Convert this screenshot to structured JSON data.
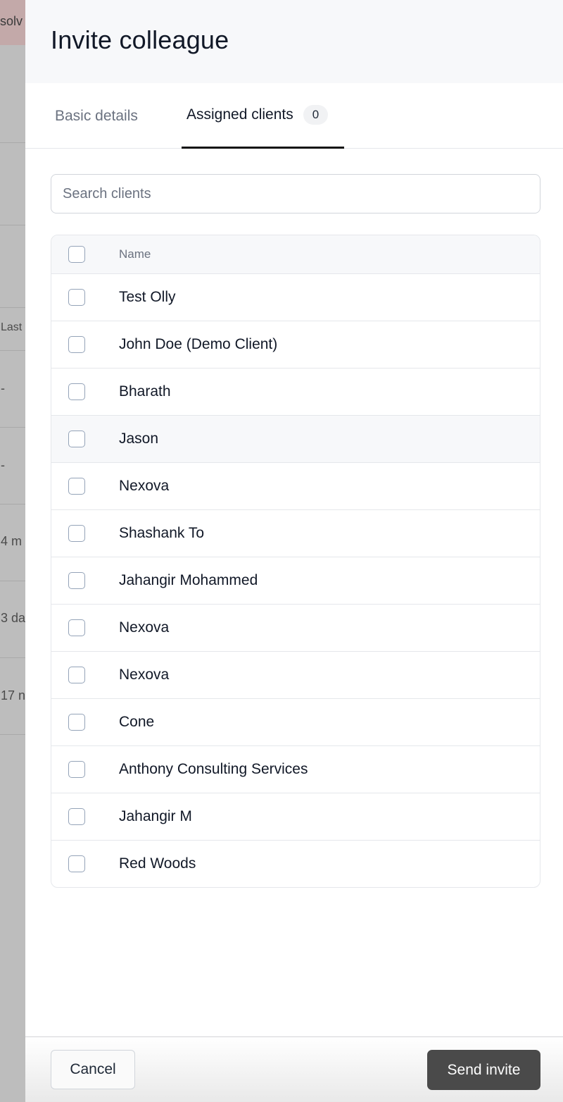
{
  "background": {
    "banner_text": "solv",
    "column_header": "Last",
    "cells": [
      "-",
      "-",
      "4 m",
      "3 da",
      "17 n"
    ]
  },
  "drawer": {
    "title": "Invite colleague",
    "tabs": [
      {
        "label": "Basic details",
        "active": false
      },
      {
        "label": "Assigned clients",
        "active": true,
        "badge": "0"
      }
    ],
    "search": {
      "placeholder": "Search clients",
      "value": ""
    },
    "table": {
      "header": {
        "name": "Name"
      },
      "rows": [
        {
          "name": "Test Olly",
          "checked": false
        },
        {
          "name": "John Doe (Demo Client)",
          "checked": false
        },
        {
          "name": "Bharath",
          "checked": false
        },
        {
          "name": "Jason",
          "checked": false
        },
        {
          "name": "Nexova",
          "checked": false
        },
        {
          "name": "Shashank To",
          "checked": false
        },
        {
          "name": "Jahangir Mohammed",
          "checked": false
        },
        {
          "name": "Nexova",
          "checked": false
        },
        {
          "name": "Nexova",
          "checked": false
        },
        {
          "name": "Cone",
          "checked": false
        },
        {
          "name": "Anthony Consulting Services",
          "checked": false
        },
        {
          "name": "Jahangir M",
          "checked": false
        },
        {
          "name": "Red Woods",
          "checked": false
        }
      ]
    },
    "footer": {
      "cancel_label": "Cancel",
      "send_label": "Send invite"
    }
  }
}
